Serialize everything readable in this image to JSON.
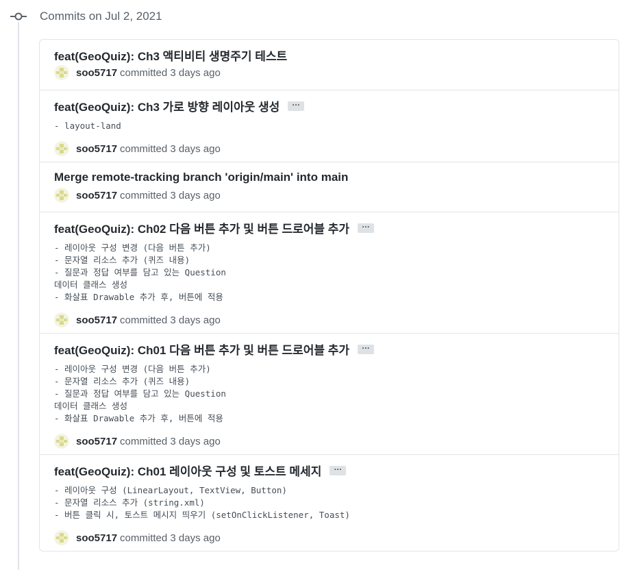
{
  "group": {
    "title": "Commits on Jul 2, 2021"
  },
  "commits": [
    {
      "title": "feat(GeoQuiz): Ch3 액티비티 생명주기 테스트",
      "has_more": false,
      "description": "",
      "author": "soo5717",
      "action": "committed",
      "time": "3 days ago"
    },
    {
      "title": "feat(GeoQuiz): Ch3 가로 방향 레이아웃 생성",
      "has_more": true,
      "description": "- layout-land",
      "author": "soo5717",
      "action": "committed",
      "time": "3 days ago"
    },
    {
      "title": "Merge remote-tracking branch 'origin/main' into main",
      "has_more": false,
      "description": "",
      "author": "soo5717",
      "action": "committed",
      "time": "3 days ago"
    },
    {
      "title": "feat(GeoQuiz): Ch02 다음 버튼 추가 및 버튼 드로어블 추가",
      "has_more": true,
      "description": "- 레이아웃 구성 변경 (다음 버튼 추가)\n- 문자열 리소스 추가 (퀴즈 내용)\n- 질문과 정답 여부를 담고 있는 Question\n데이터 클래스 생성\n- 화살표 Drawable 추가 후, 버튼에 적용",
      "author": "soo5717",
      "action": "committed",
      "time": "3 days ago"
    },
    {
      "title": "feat(GeoQuiz): Ch01 다음 버튼 추가 및 버튼 드로어블 추가",
      "has_more": true,
      "description": "- 레이아웃 구성 변경 (다음 버튼 추가)\n- 문자열 리소스 추가 (퀴즈 내용)\n- 질문과 정답 여부를 담고 있는 Question\n데이터 클래스 생성\n- 화살표 Drawable 추가 후, 버튼에 적용",
      "author": "soo5717",
      "action": "committed",
      "time": "3 days ago"
    },
    {
      "title": "feat(GeoQuiz): Ch01 레이아웃 구성 및 토스트 메세지",
      "has_more": true,
      "description": "- 레이아웃 구성 (LinearLayout, TextView, Button)\n- 문자열 리소스 추가 (string.xml)\n- 버튼 클릭 시, 토스트 메시지 띄우기 (setOnClickListener, Toast)",
      "author": "soo5717",
      "action": "committed",
      "time": "3 days ago"
    }
  ],
  "ellipsis_label": "…",
  "icons": {
    "timeline": "git-commit-icon",
    "avatar": "identicon-avatar"
  },
  "colors": {
    "avatar": "#d9d98c",
    "timeline": "#e1e4e8",
    "muted_text": "#586069"
  }
}
